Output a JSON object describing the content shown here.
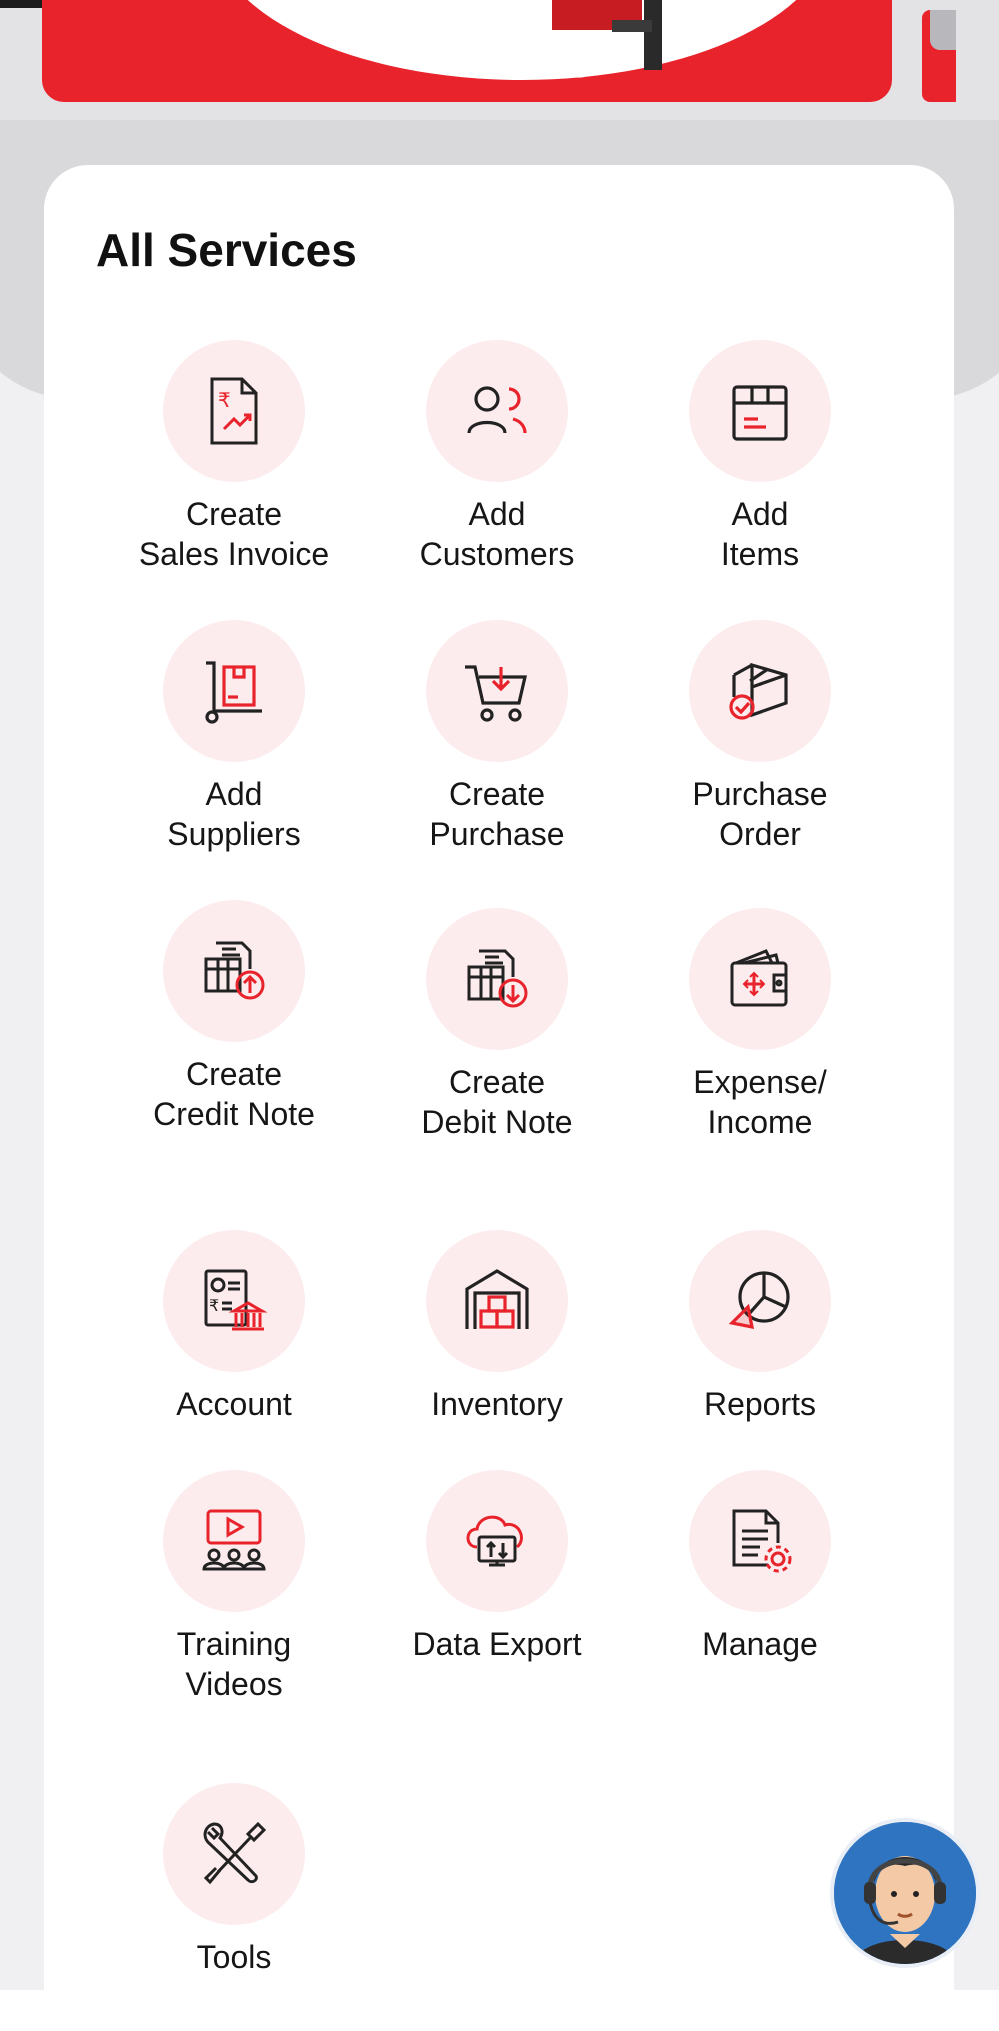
{
  "colors": {
    "accent": "#e8232b",
    "icon_circle": "#fcecee",
    "icon_stroke": "#222222"
  },
  "banner": {
    "carousel_total": 3,
    "carousel_active_index": 0
  },
  "services": {
    "title": "All Services",
    "items": [
      {
        "label": "Create\nSales Invoice",
        "icon": "invoice-rupee-icon"
      },
      {
        "label": "Add\nCustomers",
        "icon": "customers-icon"
      },
      {
        "label": "Add\nItems",
        "icon": "items-box-icon"
      },
      {
        "label": "Add\nSuppliers",
        "icon": "hand-trolley-icon"
      },
      {
        "label": "Create\nPurchase",
        "icon": "shopping-cart-icon"
      },
      {
        "label": "Purchase\nOrder",
        "icon": "package-check-icon"
      },
      {
        "label": "Create\nCredit Note",
        "icon": "credit-note-icon"
      },
      {
        "label": "Create\nDebit Note",
        "icon": "debit-note-icon"
      },
      {
        "label": "Expense/\nIncome",
        "icon": "wallet-icon"
      },
      {
        "label": "Account",
        "icon": "bank-account-icon"
      },
      {
        "label": "Inventory",
        "icon": "warehouse-icon"
      },
      {
        "label": "Reports",
        "icon": "pie-chart-icon"
      },
      {
        "label": "Training\nVideos",
        "icon": "video-training-icon"
      },
      {
        "label": "Data Export",
        "icon": "cloud-export-icon"
      },
      {
        "label": "Manage",
        "icon": "document-gear-icon"
      },
      {
        "label": "Tools",
        "icon": "tools-icon"
      }
    ]
  },
  "support": {
    "icon": "support-agent-icon"
  }
}
